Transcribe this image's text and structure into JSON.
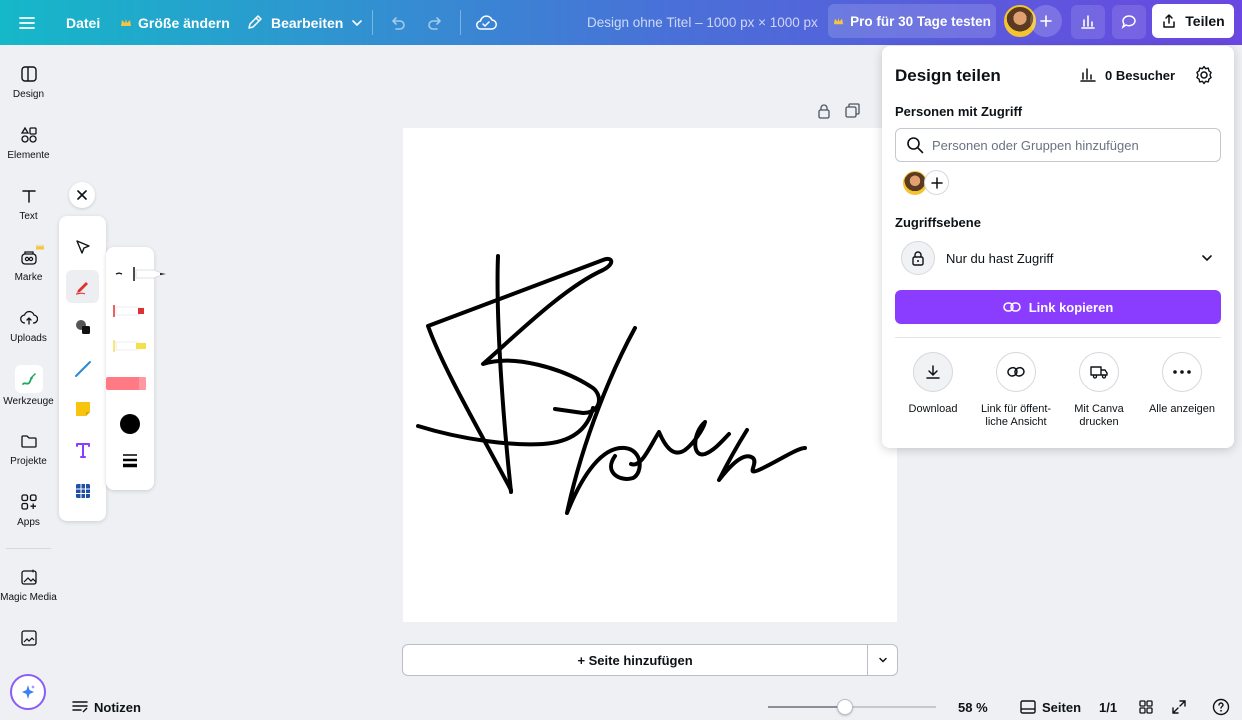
{
  "topbar": {
    "file_label": "Datei",
    "resize_label": "Größe ändern",
    "edit_label": "Bearbeiten",
    "doc_title": "Design ohne Titel – 1000 px × 1000 px",
    "pro_label": "Pro für 30 Tage testen",
    "share_label": "Teilen"
  },
  "leftnav": {
    "items": [
      {
        "label": "Design",
        "icon": "layout-icon"
      },
      {
        "label": "Elemente",
        "icon": "elements-icon"
      },
      {
        "label": "Text",
        "icon": "text-icon"
      },
      {
        "label": "Marke",
        "icon": "brand-icon"
      },
      {
        "label": "Uploads",
        "icon": "upload-icon"
      },
      {
        "label": "Werkzeuge",
        "icon": "tools-icon"
      },
      {
        "label": "Projekte",
        "icon": "folder-icon"
      },
      {
        "label": "Apps",
        "icon": "apps-icon"
      },
      {
        "label": "Magic Media",
        "icon": "magic-media-icon"
      }
    ]
  },
  "draw_tools": {
    "tools": [
      "select-icon",
      "pen-icon",
      "shapes-icon",
      "line-icon",
      "sticky-note-icon",
      "text-tool-icon",
      "table-icon"
    ]
  },
  "canvas": {
    "signature_color": "#000000"
  },
  "add_page": {
    "label": "+ Seite hinzufügen"
  },
  "bottombar": {
    "notes_label": "Notizen",
    "zoom_value": "58 %",
    "zoom_fraction": 0.46,
    "pages_label": "Seiten",
    "page_count": "1/1"
  },
  "share_panel": {
    "title": "Design teilen",
    "visitors": "0 Besucher",
    "people_access_label": "Personen mit Zugriff",
    "search_placeholder": "Personen oder Gruppen hinzufügen",
    "access_level_label": "Zugriffsebene",
    "access_value": "Nur du hast Zugriff",
    "copy_link_label": "Link kopieren",
    "accent": "#8b3dff",
    "actions": [
      {
        "label": "Download",
        "icon": "download-icon"
      },
      {
        "label": "Link für öffent-\nliche Ansicht",
        "icon": "link-icon"
      },
      {
        "label": "Mit Canva\ndrucken",
        "icon": "truck-icon"
      },
      {
        "label": "Alle anzeigen",
        "icon": "more-icon"
      }
    ]
  }
}
